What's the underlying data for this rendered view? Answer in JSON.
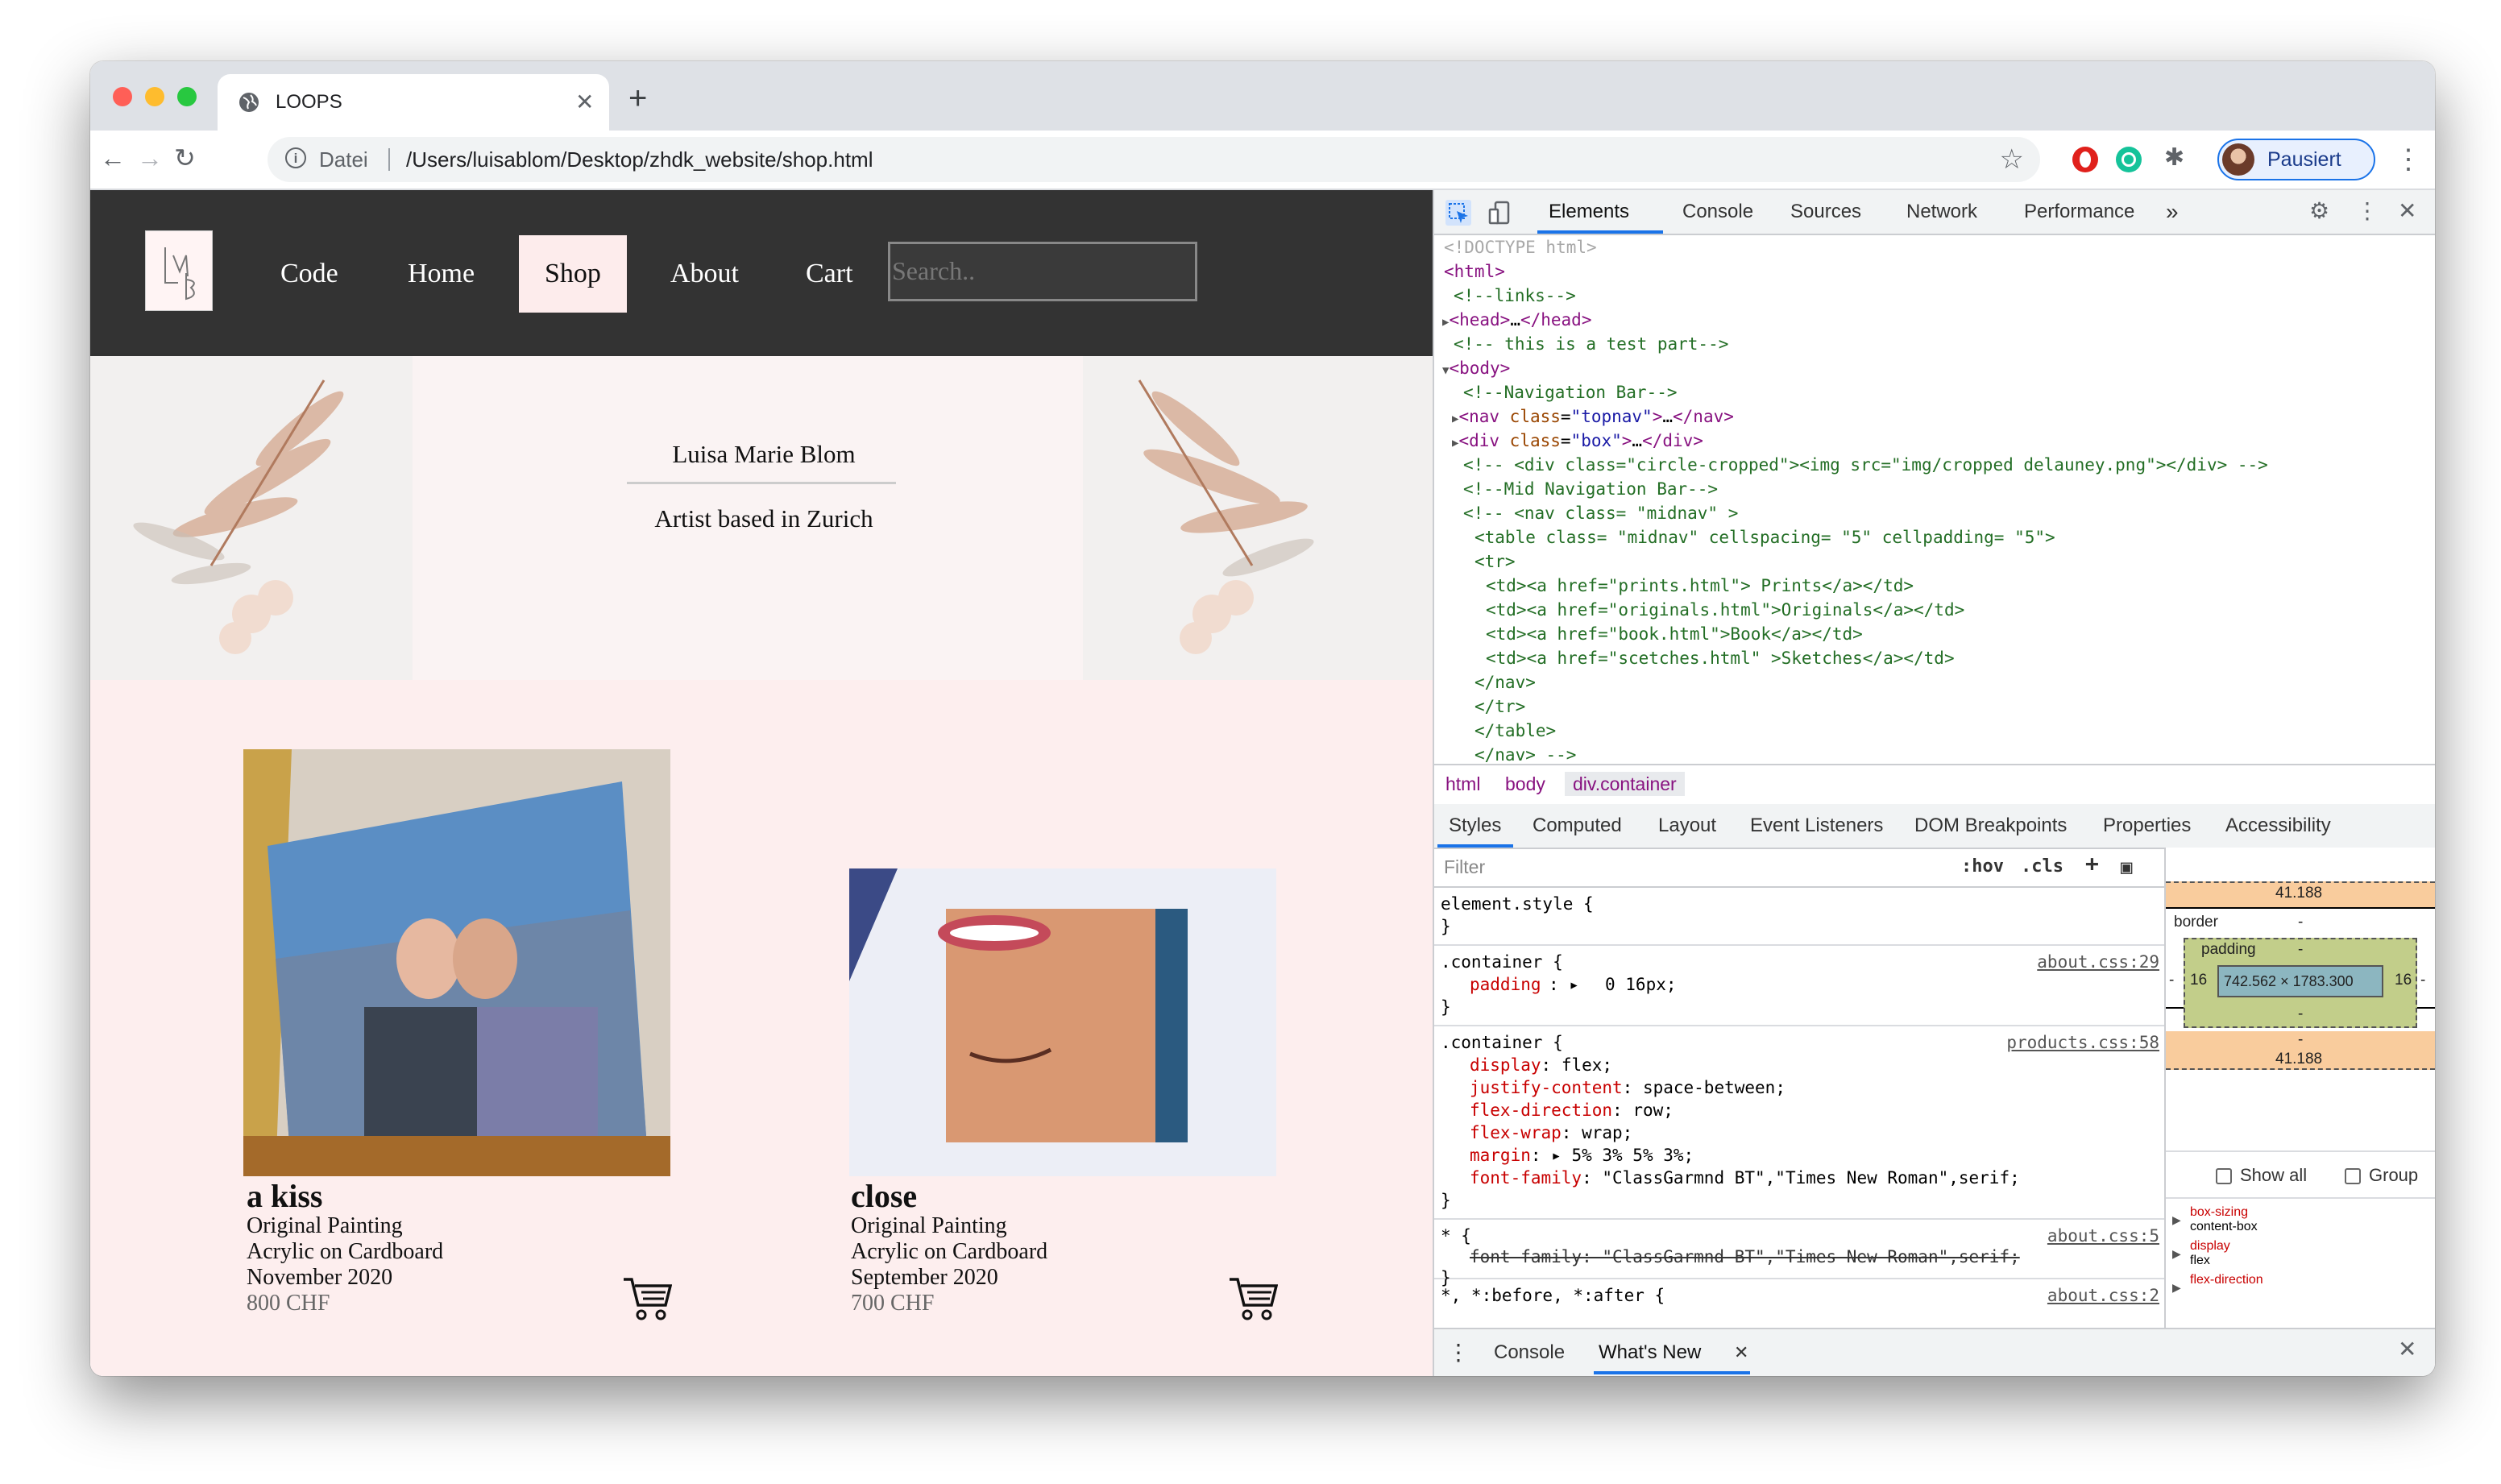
{
  "browser": {
    "tab_title": "LOOPS",
    "address_scheme": "Datei",
    "address_url": "/Users/luisablom/Desktop/zhdk_website/shop.html",
    "profile_label": "Pausiert"
  },
  "site": {
    "logo_text": "LMB",
    "nav": [
      "Code",
      "Home",
      "Shop",
      "About",
      "Cart"
    ],
    "active_nav": "Shop",
    "search_placeholder": "Search..",
    "artist_name": "Luisa Marie Blom",
    "artist_sub": "Artist based in Zurich",
    "products": [
      {
        "title": "a kiss",
        "type": "Original Painting",
        "medium": "Acrylic on Cardboard",
        "date": "November 2020",
        "price": "800 CHF"
      },
      {
        "title": "close",
        "type": "Original Painting",
        "medium": "Acrylic on Cardboard",
        "date": "September 2020",
        "price": "700 CHF"
      }
    ]
  },
  "devtools": {
    "tabs": [
      "Elements",
      "Console",
      "Sources",
      "Network",
      "Performance"
    ],
    "more_tabs": "»",
    "breadcrumbs": [
      "html",
      "body",
      "div.container"
    ],
    "sub_tabs": [
      "Styles",
      "Computed",
      "Layout",
      "Event Listeners",
      "DOM Breakpoints",
      "Properties",
      "Accessibility"
    ],
    "filter_placeholder": "Filter",
    "hov_label": ":hov",
    "cls_label": ".cls",
    "rules": {
      "element_style": "element.style {",
      "close_brace": "}",
      "container1_selector": ".container {",
      "container1_source": "about.css:29",
      "container1_prop": "padding",
      "container1_val": "0 16px;",
      "container2_selector": ".container {",
      "container2_source": "products.css:58",
      "container2_props": [
        {
          "name": "display",
          "value": "flex;"
        },
        {
          "name": "justify-content",
          "value": "space-between;"
        },
        {
          "name": "flex-direction",
          "value": "row;"
        },
        {
          "name": "flex-wrap",
          "value": "wrap;"
        },
        {
          "name": "margin",
          "value": "5% 3% 5% 3%;"
        },
        {
          "name": "font-family",
          "value": "\"ClassGarmnd BT\",\"Times New Roman\",serif;"
        }
      ],
      "star_selector": "* {",
      "star_source": "about.css:5",
      "star_struck": "font-family: \"ClassGarmnd BT\",\"Times New Roman\",serif;",
      "before_selector": "*, *:before, *:after {",
      "before_source": "about.css:2"
    },
    "box_model": {
      "margin_top": "41.188",
      "margin_bottom": "41.188",
      "border_label": "border",
      "border_val": "-",
      "padding_label": "padding",
      "padding_val": "-",
      "padding_left": "16",
      "padding_right": "16",
      "content_size": "742.562 × 1783.300",
      "dash": "-"
    },
    "show_all_label": "Show all",
    "group_label": "Group",
    "computed": [
      {
        "name": "box-sizing",
        "value": "content-box"
      },
      {
        "name": "display",
        "value": "flex"
      },
      {
        "name": "flex-direction",
        "value": ""
      }
    ],
    "drawer_tabs": [
      "Console",
      "What's New"
    ],
    "code_lines": [
      "<!DOCTYPE html>",
      "<html>",
      "<!--links-->",
      "<head>…</head>",
      "<!-- this is a test part-->",
      "<body>",
      "<!--Navigation Bar-->",
      "<nav class=\"topnav\">…</nav>",
      "<div class=\"box\">…</div>",
      "<!-- <div class=\"circle-cropped\"><img src=\"img/cropped delauney.png\"></div> -->",
      "<!--Mid Navigation Bar-->",
      "<!-- <nav class= \"midnav\" >",
      "<table class= \"midnav\" cellspacing= \"5\" cellpadding= \"5\">",
      "<tr>",
      "<td><a href=\"prints.html\"> Prints</a></td>",
      "<td><a href=\"originals.html\">Originals</a></td>",
      "<td><a href=\"book.html\">Book</a></td>",
      "<td><a href=\"scetches.html\" >Sketches</a></td>",
      "</nav>",
      "</tr>",
      "</table>",
      "</nav> -->"
    ]
  },
  "colors": {
    "nav_bg": "#333333",
    "nav_active_bg": "#fdecec",
    "shop_bg": "#fdeeee",
    "devtools_accent": "#1a73e8"
  }
}
